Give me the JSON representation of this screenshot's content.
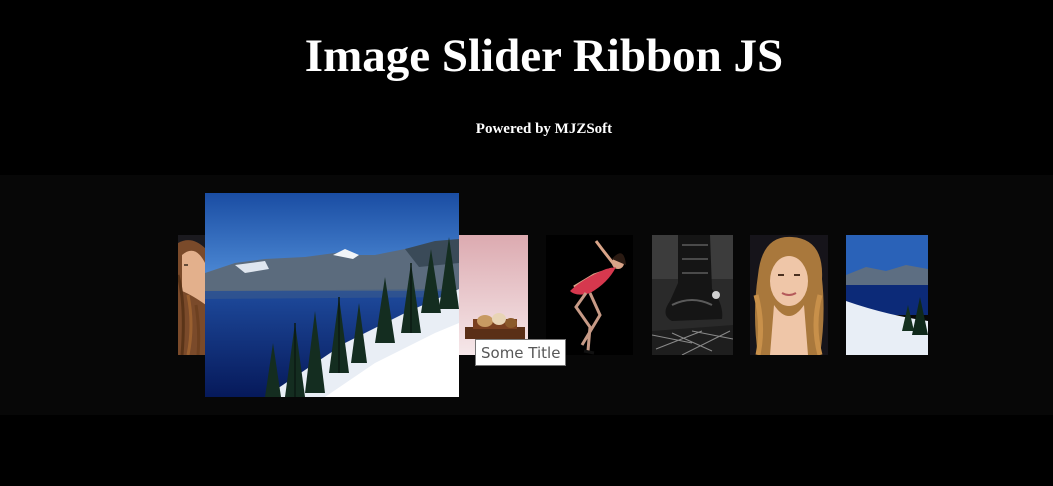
{
  "header": {
    "title": "Image Slider Ribbon JS",
    "subtitle": "Powered by MJZSoft"
  },
  "slider": {
    "tooltip": "Some Title",
    "slides": [
      {
        "name": "slide-woman-long-hair",
        "image": "portrait of a woman with long hair"
      },
      {
        "name": "slide-crater-lake-large",
        "image": "mountain lake with snowy slope and pine trees",
        "state": "active"
      },
      {
        "name": "slide-chocolates",
        "image": "chocolates on a pink background"
      },
      {
        "name": "slide-dancer-red-dress",
        "image": "woman in red dress posing"
      },
      {
        "name": "slide-boots",
        "image": "black and white boots with spurs"
      },
      {
        "name": "slide-blonde-portrait",
        "image": "portrait of a blonde woman"
      },
      {
        "name": "slide-crater-lake-small",
        "image": "mountain lake with snowy slope and pine trees"
      }
    ]
  },
  "colors": {
    "background": "#000000",
    "band": "#070707",
    "ribbon": "#0b0b0b",
    "title": "#ffffff",
    "sky": "#1c52a8",
    "pink": "#e9c3c8",
    "dress": "#d6384e"
  }
}
